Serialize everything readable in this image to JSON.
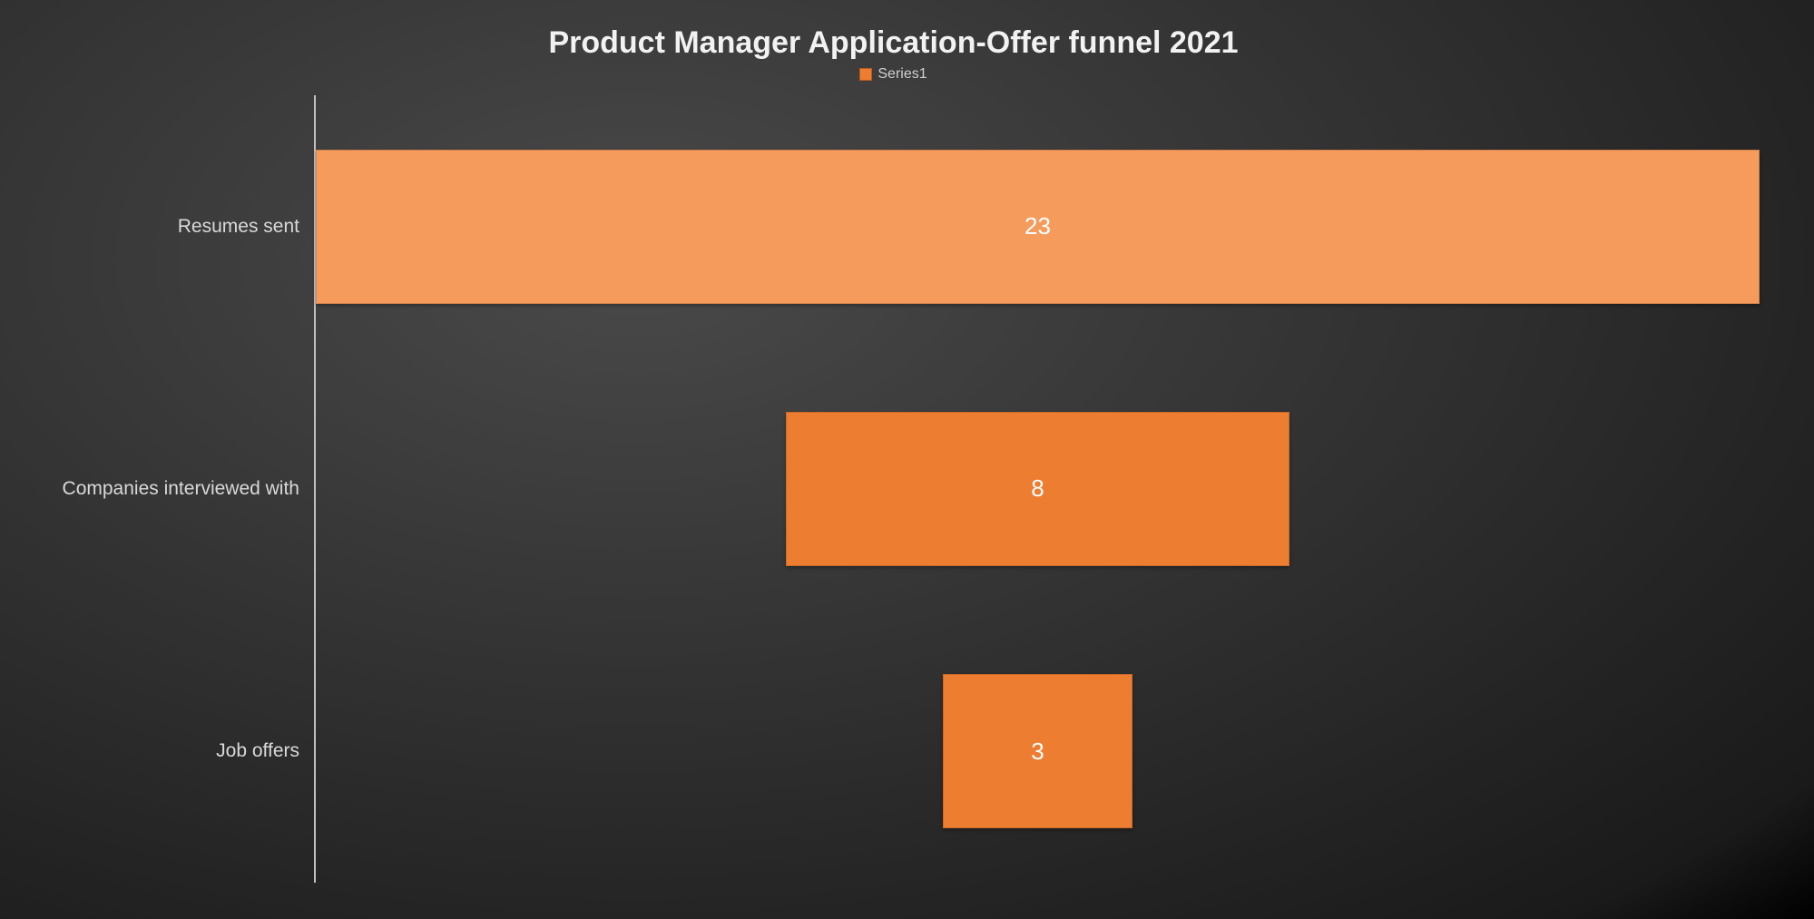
{
  "chart_data": {
    "type": "bar",
    "orientation": "horizontal-funnel",
    "title": "Product Manager Application-Offer funnel 2021",
    "categories": [
      "Resumes sent",
      "Companies interviewed with",
      "Job offers"
    ],
    "series": [
      {
        "name": "Series1",
        "values": [
          23,
          8,
          3
        ]
      }
    ],
    "colors": {
      "series1": "#ED7D31",
      "series1_light": "#F59B5C"
    },
    "max_value": 23
  }
}
